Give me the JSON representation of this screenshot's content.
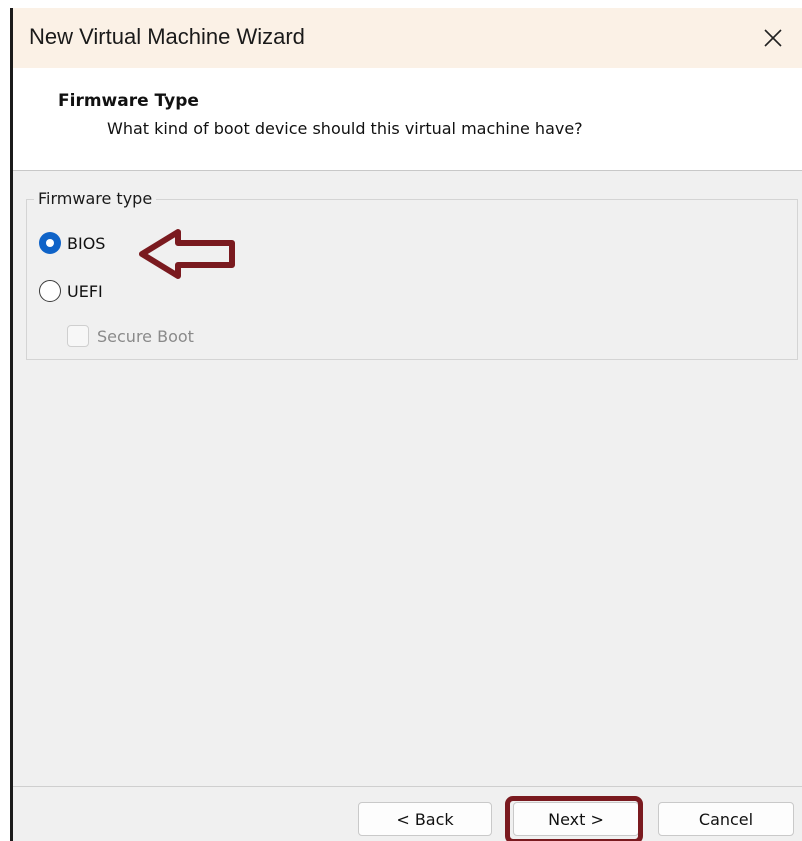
{
  "window": {
    "title": "New Virtual Machine Wizard",
    "close_icon": "close-icon"
  },
  "header": {
    "title": "Firmware Type",
    "subtitle": "What kind of boot device should this virtual machine have?"
  },
  "firmware_group": {
    "legend": "Firmware type",
    "options": [
      {
        "label": "BIOS",
        "selected": true
      },
      {
        "label": "UEFI",
        "selected": false
      }
    ],
    "secure_boot": {
      "label": "Secure Boot",
      "checked": false,
      "enabled": false
    }
  },
  "buttons": {
    "back": "< Back",
    "next": "Next >",
    "cancel": "Cancel"
  },
  "annotations": {
    "arrow_color": "#7a1a1f",
    "highlight_color": "#7a1a1f"
  }
}
